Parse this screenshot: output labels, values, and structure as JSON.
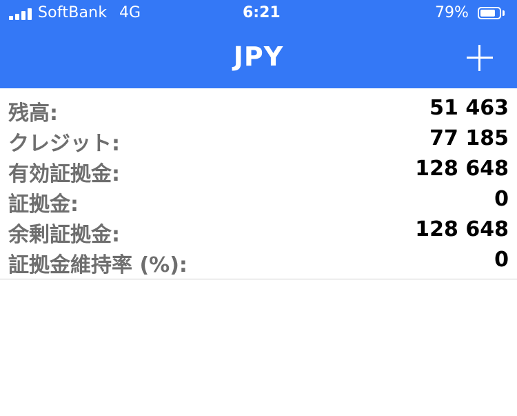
{
  "status_bar": {
    "carrier": "SoftBank",
    "network": "4G",
    "time": "6:21",
    "battery_percent": "79%",
    "battery_level": 0.79,
    "signal_bars": 4
  },
  "nav": {
    "title": "JPY",
    "add_icon": "plus-icon"
  },
  "colors": {
    "header_bg": "#3478f6",
    "label_text": "#6e6e6e",
    "value_text": "#000000"
  },
  "account": {
    "rows": [
      {
        "label": "残高:",
        "value": "51 463"
      },
      {
        "label": "クレジット:",
        "value": "77 185"
      },
      {
        "label": "有効証拠金:",
        "value": "128 648"
      },
      {
        "label": "証拠金:",
        "value": "0"
      },
      {
        "label": "余剰証拠金:",
        "value": "128 648"
      },
      {
        "label": "証拠金維持率 (%):",
        "value": "0"
      }
    ]
  }
}
